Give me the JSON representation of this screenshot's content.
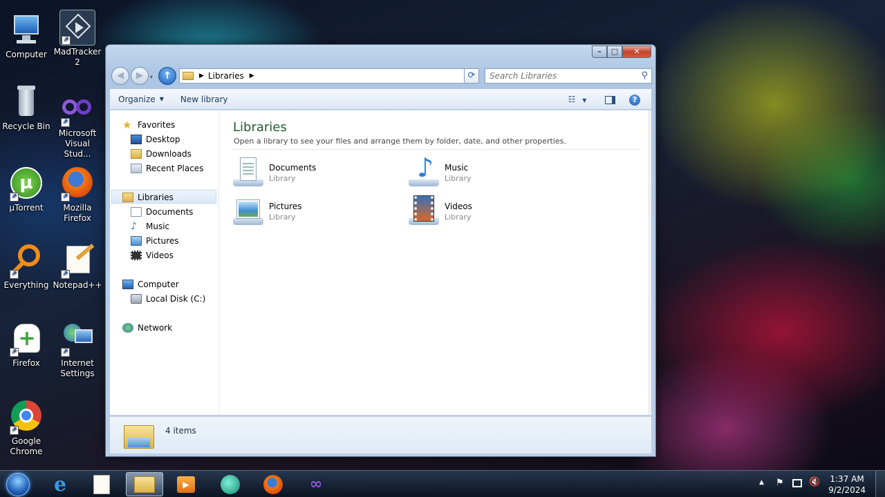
{
  "desktop": {
    "icons": [
      {
        "label": "Computer"
      },
      {
        "label": "MadTracker 2"
      },
      {
        "label": "Recycle Bin"
      },
      {
        "label": "Microsoft Visual Stud..."
      },
      {
        "label": "µTorrent"
      },
      {
        "label": "Mozilla Firefox"
      },
      {
        "label": "Everything"
      },
      {
        "label": "Notepad++"
      },
      {
        "label": "Firefox"
      },
      {
        "label": "Internet Settings"
      },
      {
        "label": "Google Chrome"
      }
    ]
  },
  "window": {
    "address": {
      "crumb": "Libraries"
    },
    "search": {
      "placeholder": "Search Libraries"
    },
    "toolbar": {
      "organize": "Organize",
      "new_library": "New library"
    },
    "nav": {
      "favorites": "Favorites",
      "desktop": "Desktop",
      "downloads": "Downloads",
      "recent": "Recent Places",
      "libraries": "Libraries",
      "documents": "Documents",
      "music": "Music",
      "pictures": "Pictures",
      "videos": "Videos",
      "computer": "Computer",
      "local_disk": "Local Disk (C:)",
      "network": "Network"
    },
    "content": {
      "title": "Libraries",
      "subtitle": "Open a library to see your files and arrange them by folder, date, and other properties.",
      "items": [
        {
          "name": "Documents",
          "type": "Library"
        },
        {
          "name": "Music",
          "type": "Library"
        },
        {
          "name": "Pictures",
          "type": "Library"
        },
        {
          "name": "Videos",
          "type": "Library"
        }
      ]
    },
    "status": {
      "count": "4 items"
    }
  },
  "taskbar": {
    "clock": {
      "time": "1:37 AM",
      "date": "9/2/2024"
    }
  },
  "colors": {
    "title_green": "#1e5d2c",
    "nav_selected": "#dbe8f6",
    "close_red": "#c2452b"
  }
}
